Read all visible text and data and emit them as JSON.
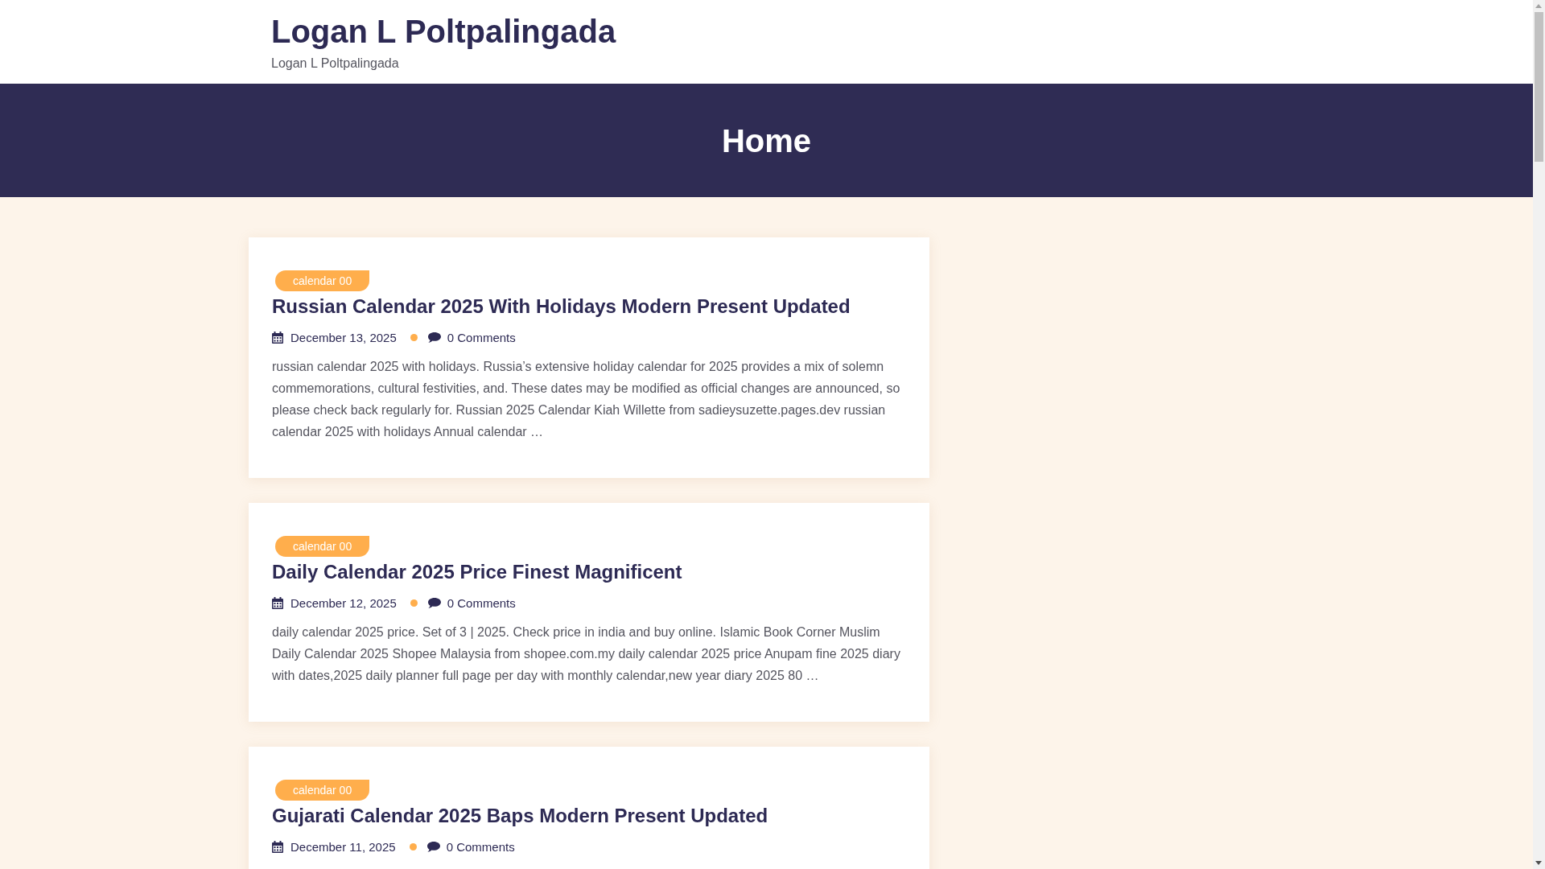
{
  "site": {
    "title": "Logan L Poltpalingada",
    "tagline": "Logan L Poltpalingada"
  },
  "banner": {
    "title": "Home"
  },
  "posts": [
    {
      "category": "calendar 00",
      "title": "Russian Calendar 2025 With Holidays Modern Present Updated",
      "date": "December 13, 2025",
      "comments": "0 Comments",
      "excerpt": "russian calendar 2025 with holidays. Russia’s extensive holiday calendar for 2025 provides a mix of solemn commemorations, cultural festivities, and. These dates may be modified as official changes are announced, so please check back regularly for. Russian 2025 Calendar Kiah Willette from sadieysuzette.pages.dev russian calendar 2025 with holidays Annual calendar …"
    },
    {
      "category": "calendar 00",
      "title": "Daily Calendar 2025 Price Finest Magnificent",
      "date": "December 12, 2025",
      "comments": "0 Comments",
      "excerpt": "daily calendar 2025 price. Set of 3 | 2025. Check price in india and buy online. Islamic Book Corner Muslim Daily Calendar 2025 Shopee Malaysia from shopee.com.my daily calendar 2025 price Anupam fine 2025 diary with dates,2025 daily planner full page per day with monthly calendar,new year diary 2025 80 …"
    },
    {
      "category": "calendar 00",
      "title": "Gujarati Calendar 2025 Baps Modern Present Updated",
      "date": "December 11, 2025",
      "comments": "0 Comments"
    }
  ]
}
